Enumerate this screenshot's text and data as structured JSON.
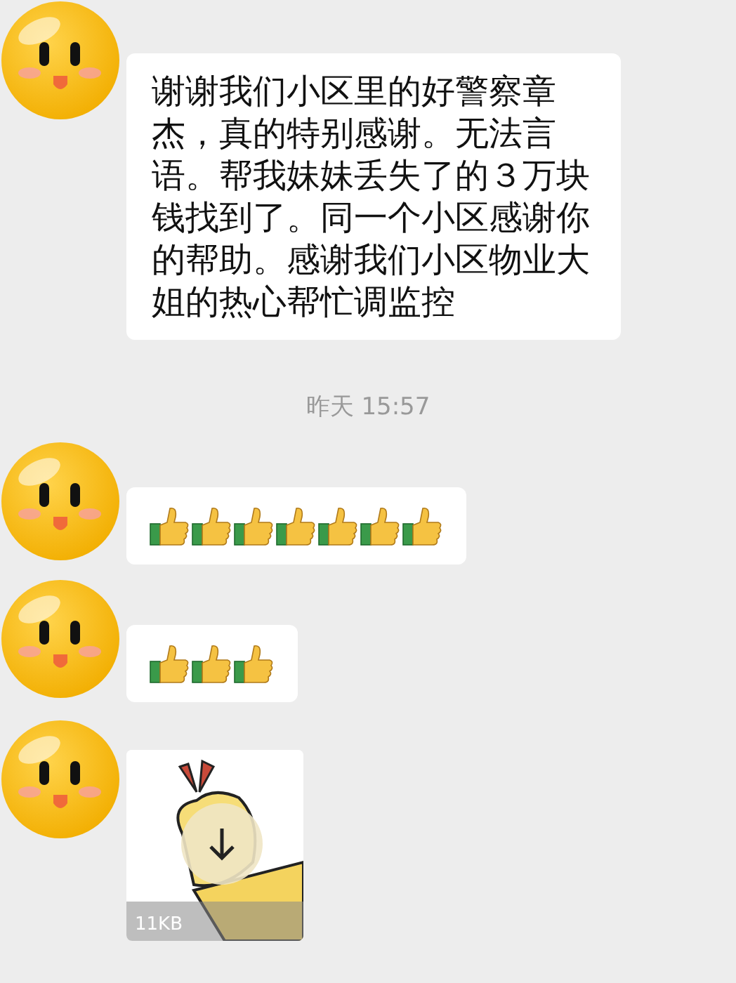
{
  "messages": [
    {
      "kind": "text",
      "text": "谢谢我们小区里的好警察章杰，真的特别感谢。无法言语。帮我妹妹丢失了的３万块钱找到了。同一个小区感谢你的帮助。感谢我们小区物业大姐的热心帮忙调监控"
    },
    {
      "kind": "time",
      "text": "昨天 15:57"
    },
    {
      "kind": "stickers",
      "stickers": [
        {
          "kind": "thumbs_up"
        },
        {
          "kind": "thumbs_up"
        },
        {
          "kind": "thumbs_up"
        },
        {
          "kind": "thumbs_up"
        },
        {
          "kind": "thumbs_up"
        },
        {
          "kind": "thumbs_up"
        },
        {
          "kind": "thumbs_up"
        }
      ]
    },
    {
      "kind": "stickers",
      "stickers": [
        {
          "kind": "thumbs_up"
        },
        {
          "kind": "thumbs_up"
        },
        {
          "kind": "thumbs_up"
        }
      ]
    },
    {
      "kind": "image_file",
      "size": "11KB"
    }
  ]
}
